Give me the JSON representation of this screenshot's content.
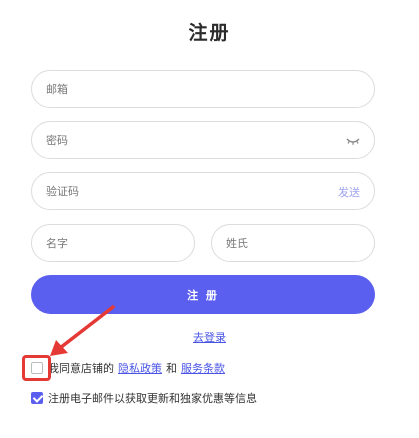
{
  "title": "注册",
  "fields": {
    "email_placeholder": "邮箱",
    "password_placeholder": "密码",
    "code_placeholder": "验证码",
    "send_label": "发送",
    "first_name_placeholder": "名字",
    "last_name_placeholder": "姓氏"
  },
  "submit_label": "注 册",
  "login_link": "去登录",
  "agree": {
    "prefix": "我同意店铺的",
    "privacy": "隐私政策",
    "and": "和",
    "terms": "服务条款",
    "checked": false
  },
  "newsletter": {
    "label": "注册电子邮件以获取更新和独家优惠等信息",
    "checked": true
  },
  "colors": {
    "accent": "#5b5fef",
    "link": "#4a55e6",
    "annotation": "#e53935"
  }
}
